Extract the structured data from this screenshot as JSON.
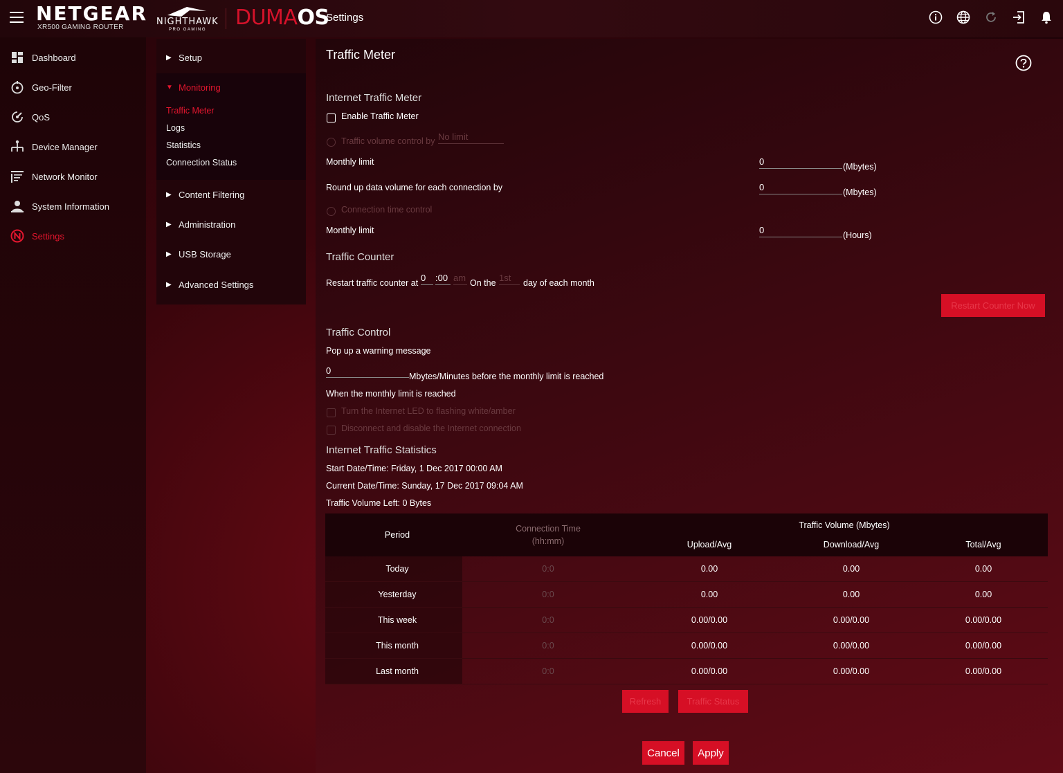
{
  "header": {
    "brand": "NETGEAR",
    "model": "XR500 GAMING ROUTER",
    "nighthawk": "NIGHTHAWK",
    "nighthawk_sub": "PRO GAMING",
    "os_part1": "DUMA",
    "os_part2": "OS",
    "page": "Settings",
    "icons": [
      "info-icon",
      "globe-icon",
      "refresh-icon",
      "logout-icon",
      "bell-icon"
    ]
  },
  "sidebar": {
    "items": [
      {
        "label": "Dashboard",
        "icon": "dashboard-icon"
      },
      {
        "label": "Geo-Filter",
        "icon": "geo-filter-icon"
      },
      {
        "label": "QoS",
        "icon": "qos-icon"
      },
      {
        "label": "Device Manager",
        "icon": "device-manager-icon"
      },
      {
        "label": "Network Monitor",
        "icon": "network-monitor-icon"
      },
      {
        "label": "System Information",
        "icon": "system-info-icon"
      },
      {
        "label": "Settings",
        "icon": "settings-icon"
      }
    ]
  },
  "submenu": {
    "setup": "Setup",
    "monitoring": "Monitoring",
    "monitoring_items": [
      "Traffic Meter",
      "Logs",
      "Statistics",
      "Connection Status"
    ],
    "content_filtering": "Content Filtering",
    "administration": "Administration",
    "usb_storage": "USB Storage",
    "advanced_settings": "Advanced Settings"
  },
  "main": {
    "title": "Traffic Meter",
    "internet_traffic_meter": {
      "heading": "Internet Traffic Meter",
      "enable_label": "Enable Traffic Meter",
      "volume_control_label": "Traffic volume control by",
      "volume_control_value": "No limit",
      "monthly_limit_label": "Monthly limit",
      "monthly_limit_value": "0",
      "mbytes_unit": "(Mbytes)",
      "round_up_label": "Round up data volume for each connection by",
      "round_up_value": "0",
      "connection_time_label": "Connection time control",
      "monthly_hours_label": "Monthly limit",
      "monthly_hours_value": "0",
      "hours_unit": "(Hours)"
    },
    "traffic_counter": {
      "heading": "Traffic Counter",
      "restart_label": "Restart traffic counter at",
      "hour": "0",
      "minute": ":00",
      "ampm": "am",
      "on_the": "On the",
      "day": "1st",
      "day_suffix": "day of each month",
      "restart_now_button": "Restart Counter Now"
    },
    "traffic_control": {
      "heading": "Traffic Control",
      "popup_label": "Pop up a warning message",
      "warning_value": "0",
      "warning_suffix": "Mbytes/Minutes before the monthly limit is reached",
      "when_reached_label": "When the monthly limit is reached",
      "led_option": "Turn the Internet LED to flashing white/amber",
      "disconnect_option": "Disconnect and disable the Internet connection"
    },
    "statistics": {
      "heading": "Internet Traffic Statistics",
      "start": "Start Date/Time: Friday, 1 Dec 2017 00:00 AM",
      "current": "Current Date/Time: Sunday, 17 Dec 2017 09:04 AM",
      "left": "Traffic Volume Left: 0 Bytes",
      "columns": {
        "period": "Period",
        "connection_time": "Connection Time",
        "connection_time_unit": "(hh:mm)",
        "traffic_volume": "Traffic Volume (Mbytes)",
        "upload": "Upload/Avg",
        "download": "Download/Avg",
        "total": "Total/Avg"
      },
      "rows": [
        {
          "period": "Today",
          "time": "0:0",
          "upload": "0.00",
          "download": "0.00",
          "total": "0.00"
        },
        {
          "period": "Yesterday",
          "time": "0:0",
          "upload": "0.00",
          "download": "0.00",
          "total": "0.00"
        },
        {
          "period": "This week",
          "time": "0:0",
          "upload": "0.00/0.00",
          "download": "0.00/0.00",
          "total": "0.00/0.00"
        },
        {
          "period": "This month",
          "time": "0:0",
          "upload": "0.00/0.00",
          "download": "0.00/0.00",
          "total": "0.00/0.00"
        },
        {
          "period": "Last month",
          "time": "0:0",
          "upload": "0.00/0.00",
          "download": "0.00/0.00",
          "total": "0.00/0.00"
        }
      ],
      "refresh_button": "Refresh",
      "traffic_status_button": "Traffic Status"
    },
    "cancel_button": "Cancel",
    "apply_button": "Apply"
  },
  "colors": {
    "accent": "#d60f25",
    "active_text": "#e3162e"
  }
}
